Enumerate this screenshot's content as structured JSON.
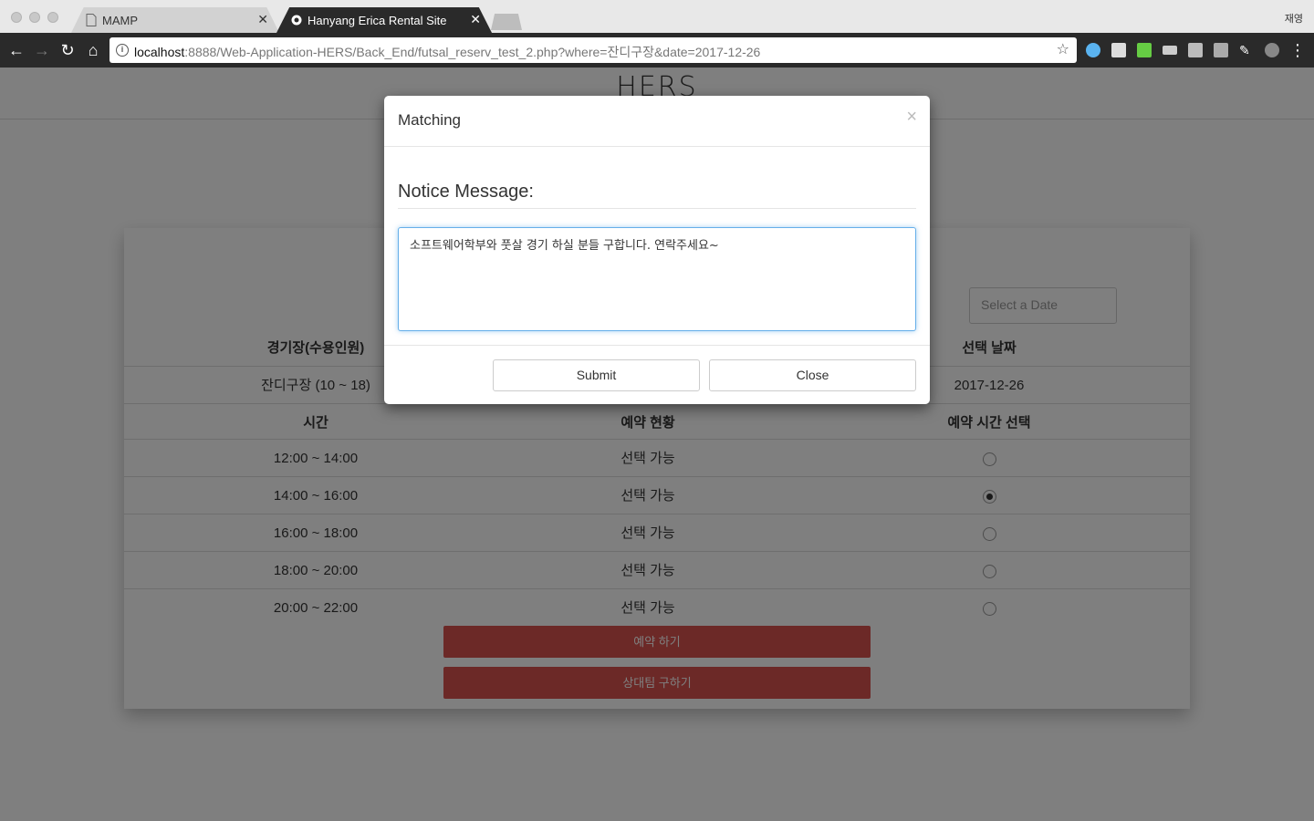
{
  "browser": {
    "tabs": [
      {
        "title": "MAMP",
        "active": false
      },
      {
        "title": "Hanyang Erica Rental Site",
        "active": true
      }
    ],
    "user": "재영",
    "url": {
      "host": "localhost",
      "rest": ":8888/Web-Application-HERS/Back_End/futsal_reserv_test_2.php?where=잔디구장&date=2017-12-26"
    }
  },
  "site": {
    "title": "HERS"
  },
  "reservation": {
    "date_placeholder": "Select a Date",
    "headers": {
      "field": "경기장(수용인원)",
      "date": "선택 날짜"
    },
    "field_value": "잔디구장 (10 ~ 18)",
    "date_value": "2017-12-26",
    "table_headers": {
      "time": "시간",
      "status": "예약 현황",
      "select": "예약 시간 선택"
    },
    "slots": [
      {
        "time": "12:00 ~ 14:00",
        "status": "선택 가능",
        "selected": false
      },
      {
        "time": "14:00 ~ 16:00",
        "status": "선택 가능",
        "selected": true
      },
      {
        "time": "16:00 ~ 18:00",
        "status": "선택 가능",
        "selected": false
      },
      {
        "time": "18:00 ~ 20:00",
        "status": "선택 가능",
        "selected": false
      },
      {
        "time": "20:00 ~ 22:00",
        "status": "선택 가능",
        "selected": false
      }
    ],
    "reserve_label": "예약 하기",
    "find_opponent_label": "상대팀 구하기"
  },
  "modal": {
    "title": "Matching",
    "close_glyph": "×",
    "notice_label": "Notice Message:",
    "message": "소프트웨어학부와 풋살 경기 하실 분들 구합니다. 연락주세요~",
    "submit_label": "Submit",
    "close_label": "Close"
  },
  "colors": {
    "accent_red": "#d9534f",
    "focus_blue": "#66afe9"
  }
}
